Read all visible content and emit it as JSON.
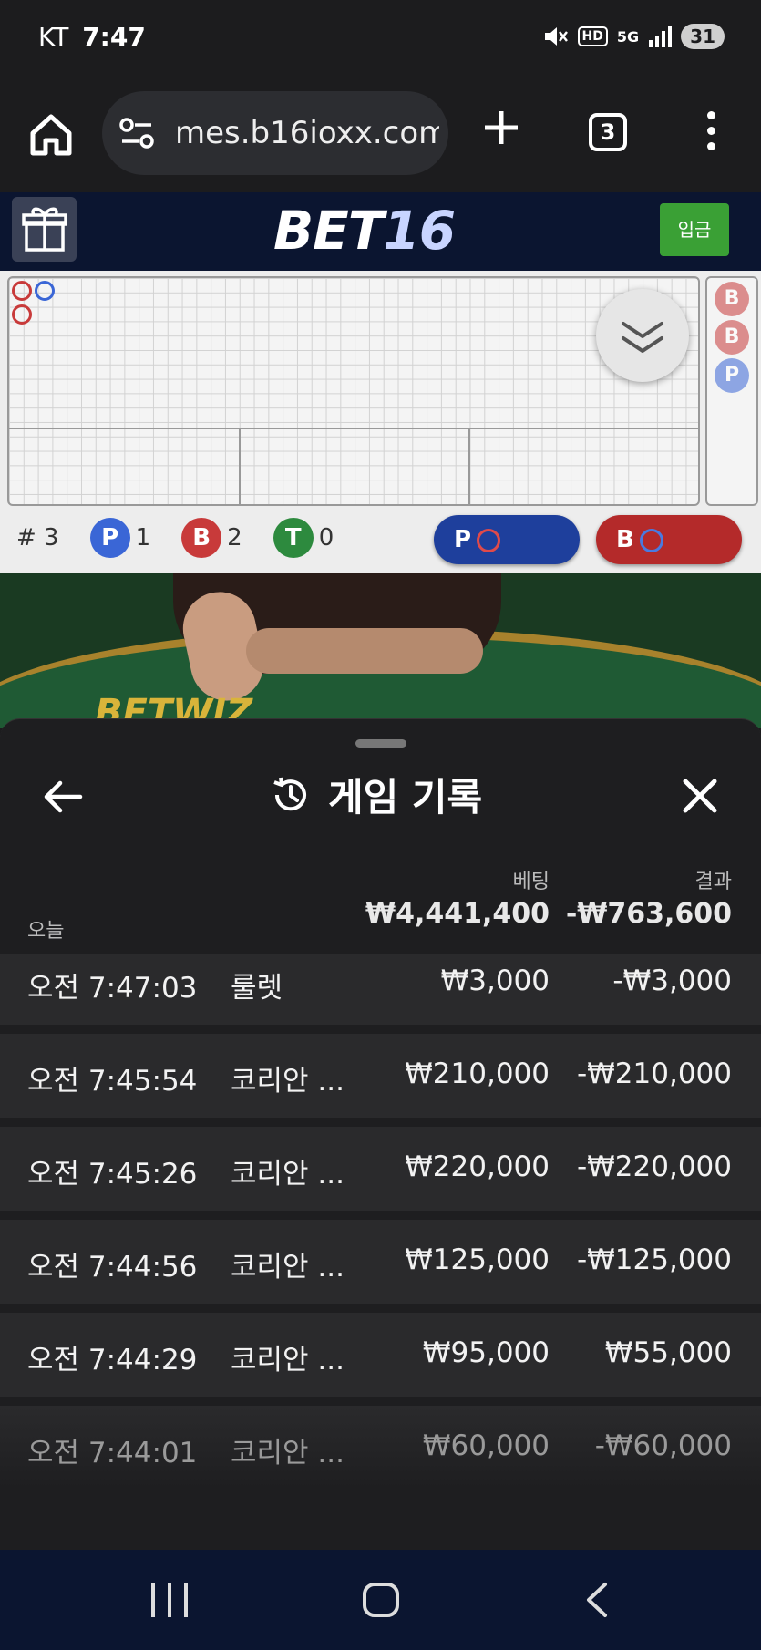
{
  "status_bar": {
    "carrier": "KT",
    "time": "7:47",
    "battery": "31",
    "hd_label": "HD",
    "network": "5G"
  },
  "browser": {
    "url": "mes.b16ioxx.com",
    "tab_count": "3"
  },
  "site": {
    "logo_main": "BET",
    "logo_num": "16",
    "deposit_label": "입금"
  },
  "scoreboard": {
    "total_label": "# 3",
    "stats": [
      {
        "letter": "P",
        "count": "1"
      },
      {
        "letter": "B",
        "count": "2"
      },
      {
        "letter": "T",
        "count": "0"
      }
    ],
    "side_road": [
      "B",
      "B",
      "P"
    ],
    "ask_player": "P",
    "ask_banker": "B"
  },
  "video": {
    "brand": "BETWIZ"
  },
  "history": {
    "title": "게임 기록",
    "col_bet": "베팅",
    "col_result": "결과",
    "today_label": "오늘",
    "today_bet": "₩4,441,400",
    "today_result": "-₩763,600",
    "rows": [
      {
        "time": "오전 7:47:03",
        "game": "룰렛",
        "bet": "₩3,000",
        "result": "-₩3,000"
      },
      {
        "time": "오전 7:45:54",
        "game": "코리안 ...",
        "bet": "₩210,000",
        "result": "-₩210,000"
      },
      {
        "time": "오전 7:45:26",
        "game": "코리안 ...",
        "bet": "₩220,000",
        "result": "-₩220,000"
      },
      {
        "time": "오전 7:44:56",
        "game": "코리안 ...",
        "bet": "₩125,000",
        "result": "-₩125,000"
      },
      {
        "time": "오전 7:44:29",
        "game": "코리안 ...",
        "bet": "₩95,000",
        "result": "₩55,000"
      },
      {
        "time": "오전 7:44:01",
        "game": "코리안 ...",
        "bet": "₩60,000",
        "result": "-₩60,000"
      }
    ]
  },
  "icons": [
    "home-icon",
    "site-settings-icon",
    "plus-icon",
    "more-icon",
    "gift-icon",
    "chevron-double-down-icon",
    "back-arrow-icon",
    "history-icon",
    "close-icon"
  ]
}
